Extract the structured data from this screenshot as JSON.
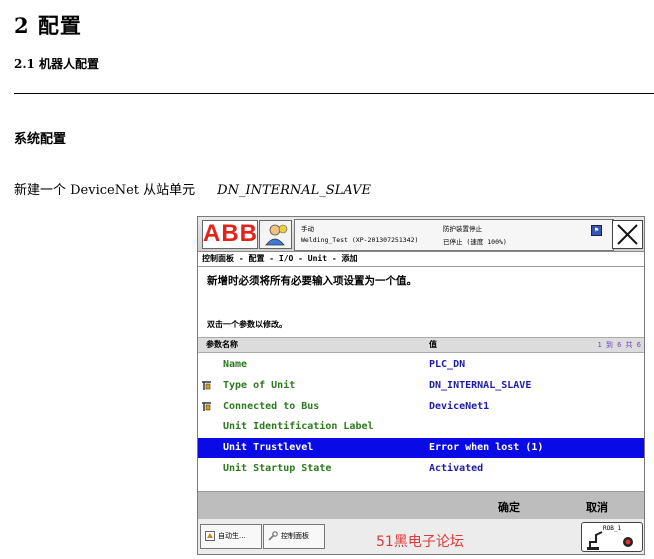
{
  "doc": {
    "heading1": "2  配置",
    "heading2": "2.1  机器人配置",
    "section": "系统配置",
    "intro_text": "新建一个 DeviceNet 从站单元",
    "intro_code": "DN_INTERNAL_SLAVE"
  },
  "pendant": {
    "logo": "ABB",
    "status": {
      "mode": "手动",
      "station": "Welding_Test (XP-201307251342)",
      "safety": "防护装置停止",
      "run_state": "已停止 (速度 100%)"
    },
    "breadcrumb": "控制面板 - 配置 - I/O - Unit - 添加",
    "message": "新增时必须将所有必要输入项设置为一个值。",
    "hint": "双击一个参数以修改。",
    "table": {
      "col_name": "参数名称",
      "col_value": "值",
      "page_info": "1 到 6 共 6",
      "rows": [
        {
          "name": "Name",
          "value": "PLC_DN",
          "required": false,
          "selected": false
        },
        {
          "name": "Type of Unit",
          "value": "DN_INTERNAL_SLAVE",
          "required": true,
          "selected": false
        },
        {
          "name": "Connected to Bus",
          "value": "DeviceNet1",
          "required": true,
          "selected": false
        },
        {
          "name": "Unit Identification Label",
          "value": "",
          "required": false,
          "selected": false
        },
        {
          "name": "Unit Trustlevel",
          "value": "Error when lost (1)",
          "required": false,
          "selected": true
        },
        {
          "name": "Unit Startup State",
          "value": "Activated",
          "required": false,
          "selected": false
        }
      ]
    },
    "buttons": {
      "ok": "确定",
      "cancel": "取消"
    },
    "taskbar": {
      "task1": "自动生...",
      "task2": "控制面板",
      "rob_label": "ROB_1"
    },
    "watermark": "51黑电子论坛",
    "colors": {
      "selection": "#0a0ae6",
      "param_name": "#2c7a1e",
      "param_value": "#1c1ca8",
      "logo_red": "#e2231a"
    }
  }
}
